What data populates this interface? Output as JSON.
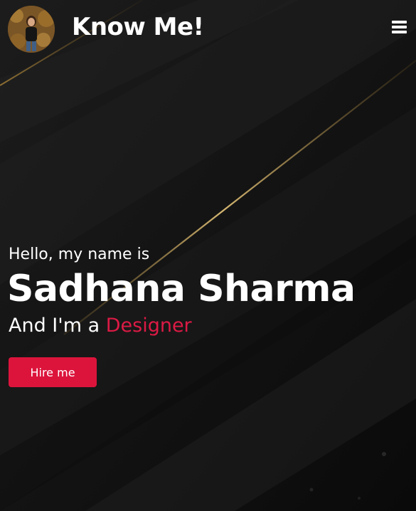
{
  "navbar": {
    "brand": "Know Me!",
    "avatar_icon": "profile-photo",
    "menu_icon": "hamburger-menu-icon"
  },
  "hero": {
    "greeting": "Hello, my name is",
    "name": "Sadhana Sharma",
    "role_prefix": "And I'm a",
    "role": "Designer",
    "cta_label": "Hire me"
  },
  "colors": {
    "background": "#0b0b0b",
    "text": "#ffffff",
    "accent": "#dc143c",
    "gold_stripe": "#c9a14a"
  }
}
